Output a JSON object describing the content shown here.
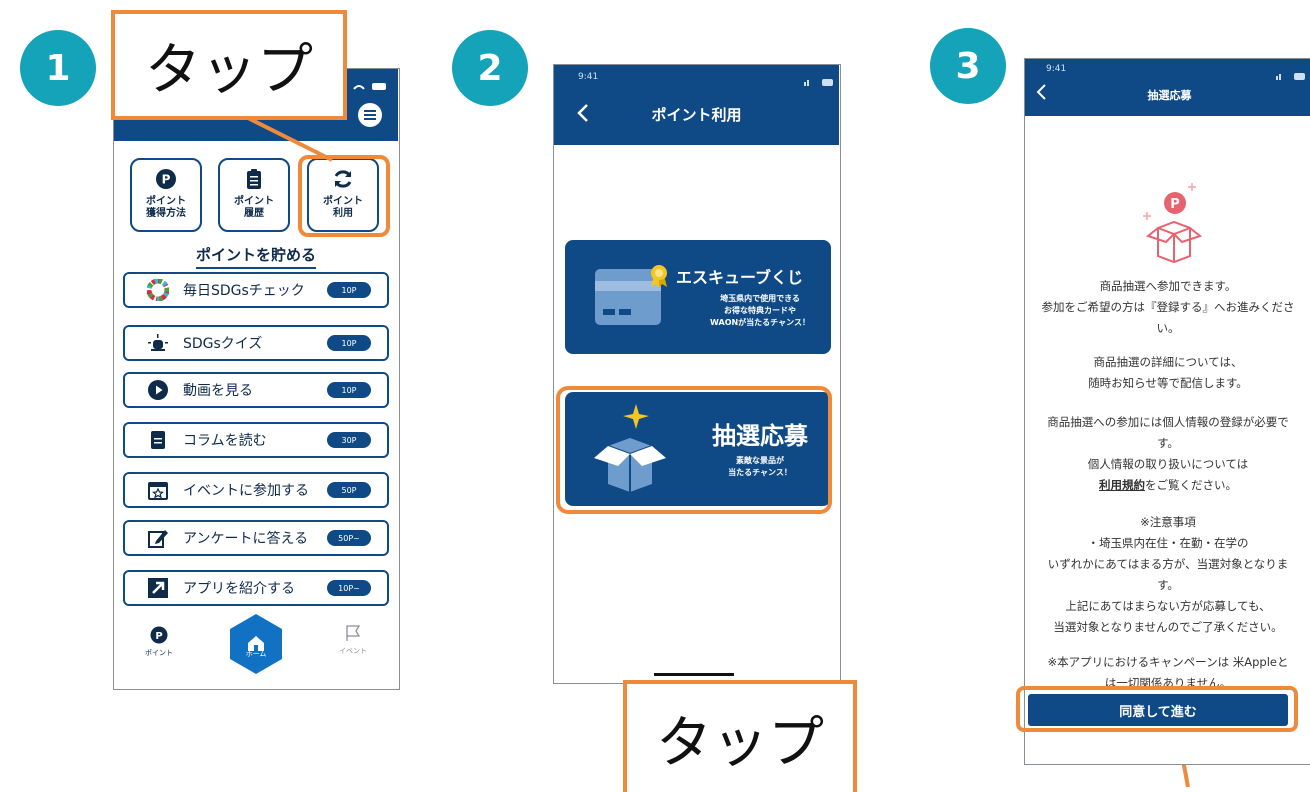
{
  "steps": [
    "1",
    "2",
    "3"
  ],
  "callouts": {
    "top": "タップ",
    "bottom": "タップ"
  },
  "phone1": {
    "quick_buttons": [
      {
        "label": "ポイント\n獲得方法",
        "icon": "p-coin-icon"
      },
      {
        "label": "ポイント\n履歴",
        "icon": "clipboard-icon"
      },
      {
        "label": "ポイント\n利用",
        "icon": "refresh-icon"
      }
    ],
    "section_title": "ポイントを貯める",
    "items": [
      {
        "label": "毎日SDGsチェック",
        "points": "10P",
        "icon": "sdgs-wheel-icon"
      },
      {
        "label": "SDGsクイズ",
        "points": "10P",
        "icon": "quiz-buzzer-icon"
      },
      {
        "label": "動画を見る",
        "points": "10P",
        "icon": "play-icon"
      },
      {
        "label": "コラムを読む",
        "points": "30P",
        "icon": "document-icon"
      },
      {
        "label": "イベントに参加する",
        "points": "50P",
        "icon": "calendar-star-icon"
      },
      {
        "label": "アンケートに答える",
        "points": "50P~",
        "icon": "edit-icon"
      },
      {
        "label": "アプリを紹介する",
        "points": "10P~",
        "icon": "share-arrow-icon"
      }
    ],
    "tabs": {
      "point": "ポイント",
      "home": "ホーム",
      "event": "イベント"
    }
  },
  "phone2": {
    "time": "9:41",
    "title": "ポイント利用",
    "card1": {
      "title": "エスキューブくじ",
      "desc": [
        "埼玉県内で使用できる",
        "お得な特典カードや",
        "WAONが当たるチャンス！"
      ]
    },
    "card2": {
      "title": "抽選応募",
      "desc": [
        "素敵な景品が",
        "当たるチャンス！"
      ]
    }
  },
  "phone3": {
    "time": "9:41",
    "title": "抽選応募",
    "paragraphs": [
      [
        "商品抽選へ参加できます。",
        "参加をご希望の方は『登録する』へお進みくださ",
        "い。"
      ],
      [
        "商品抽選の詳細については、",
        "随時お知らせ等で配信します。"
      ],
      [
        "商品抽選への参加には個人情報の登録が必要で",
        "す。",
        "個人情報の取り扱いについては"
      ],
      [
        "※注意事項",
        "・埼玉県内在住・在勤・在学の",
        "いずれかにあてはまる方が、当選対象となりま",
        "す。",
        "上記にあてはまらない方が応募しても、",
        "当選対象となりませんのでご了承ください。"
      ],
      [
        "※本アプリにおけるキャンペーンは 米Appleと",
        "は一切関係ありません。"
      ]
    ],
    "terms_link": "利用規約",
    "terms_suffix": "をご覧ください。",
    "agree_button": "同意して進む"
  },
  "colors": {
    "navy": "#0f4a86",
    "orange": "#ef8a3a",
    "teal": "#14a3b8"
  }
}
